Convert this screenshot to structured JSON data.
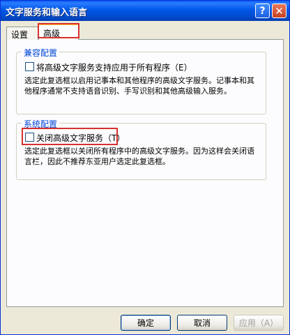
{
  "window": {
    "title": "文字服务和输入语言",
    "help_symbol": "?",
    "close_symbol": "✕"
  },
  "tabs": [
    {
      "label": "设置"
    },
    {
      "label": "高级"
    }
  ],
  "compat_group": {
    "legend": "兼容配置",
    "checkbox_label": "将高级文字服务支持应用于所有程序（E）",
    "checked": false,
    "description": "选定此复选框以启用记事本和其他程序的高级文字服务。记事本和其他程序通常不支持语音识别、手写识别和其他高级输入服务。"
  },
  "system_group": {
    "legend": "系统配置",
    "checkbox_label": "关闭高级文字服务（T）",
    "checked": false,
    "description": "选定此复选框以关闭所有程序中的高级文字服务。因为这样会关闭语言栏，因此不推荐东亚用户选定此复选框。"
  },
  "buttons": {
    "ok": "确定",
    "cancel": "取消",
    "apply": "应用（A）"
  }
}
